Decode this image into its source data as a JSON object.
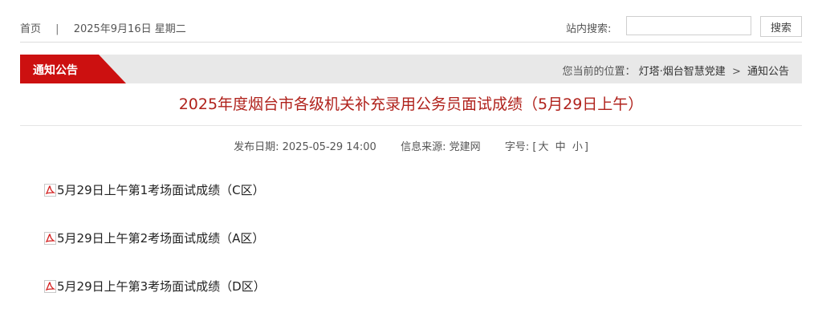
{
  "topbar": {
    "home": "首页",
    "sep": "|",
    "date": "2025年9月16日 星期二",
    "search_label": "站内搜索:",
    "search_value": "",
    "search_button": "搜索"
  },
  "column": {
    "tag": "通知公告",
    "crumb_prefix": "您当前的位置：",
    "crumb_site": "灯塔·烟台智慧党建",
    "crumb_arrow": ">",
    "crumb_current": "通知公告"
  },
  "article": {
    "title": "2025年度烟台市各级机关补充录用公务员面试成绩（5月29日上午）",
    "publish_label": "发布日期:",
    "publish_date": "2025-05-29 14:00",
    "source_label": "信息来源:",
    "source": "党建网",
    "fontsize_label": "字号:",
    "bracket_open": "[",
    "size_large": "大",
    "size_medium": "中",
    "size_small": "小",
    "bracket_close": "]"
  },
  "attachments": [
    {
      "label": "5月29日上午第1考场面试成绩（C区）",
      "icon": "pdf-icon"
    },
    {
      "label": "5月29日上午第2考场面试成绩（A区）",
      "icon": "pdf-icon"
    },
    {
      "label": "5月29日上午第3考场面试成绩（D区）",
      "icon": "pdf-icon"
    }
  ],
  "colors": {
    "accent": "#cc1010",
    "title": "#b0221c"
  }
}
